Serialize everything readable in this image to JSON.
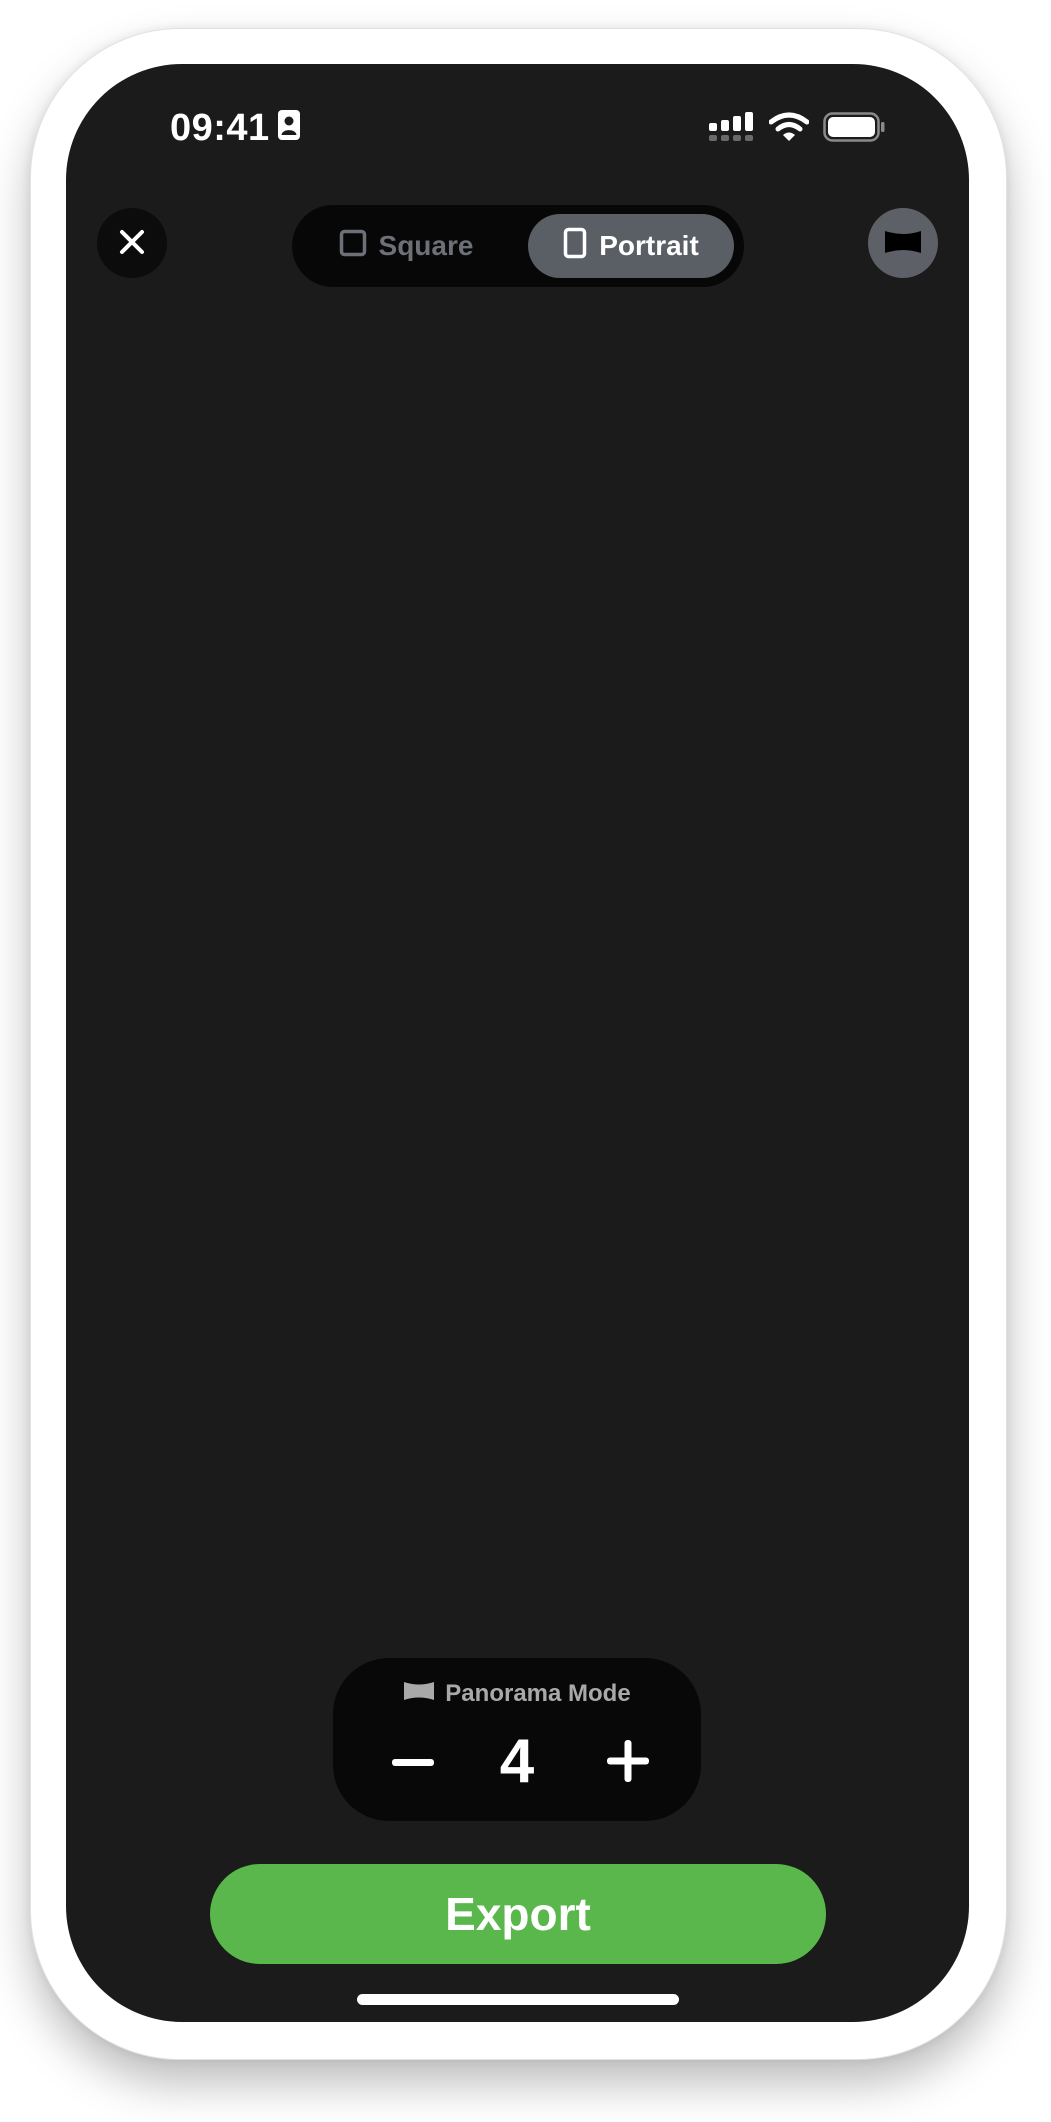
{
  "status_bar": {
    "time": "09:41",
    "signal_icon": "cellular-signal-icon",
    "wifi_icon": "wifi-icon",
    "battery_icon": "battery-icon",
    "id_icon": "contact-card-icon"
  },
  "toolbar": {
    "close_icon": "close-icon",
    "aspect_options": [
      {
        "label": "Square",
        "icon": "square-icon",
        "selected": false
      },
      {
        "label": "Portrait",
        "icon": "portrait-icon",
        "selected": true
      }
    ],
    "panorama_icon": "panorama-icon"
  },
  "panorama_control": {
    "title": "Panorama Mode",
    "title_icon": "panorama-icon",
    "decrement_label": "−",
    "value": "4",
    "increment_label": "+"
  },
  "export": {
    "label": "Export"
  },
  "colors": {
    "screen_bg": "#1b1b1b",
    "accent_green": "#5ab74b",
    "segment_selected": "#5a5e65",
    "segment_inactive_text": "#6d7177"
  }
}
